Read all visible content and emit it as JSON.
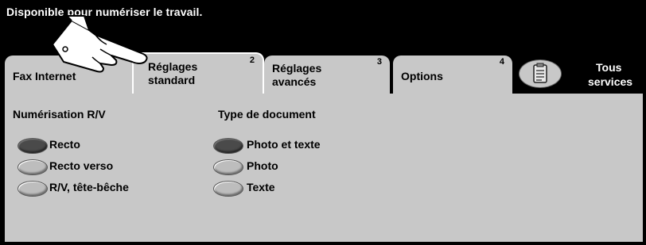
{
  "status": {
    "message": "Disponible pour numériser le travail."
  },
  "tabs": [
    {
      "label": "Fax Internet",
      "number": ""
    },
    {
      "label_line1": "Réglages",
      "label_line2": "standard",
      "number": "2"
    },
    {
      "label_line1": "Réglages",
      "label_line2": "avancés",
      "number": "3"
    },
    {
      "label": "Options",
      "number": "4"
    }
  ],
  "all_services": {
    "line1": "Tous",
    "line2": "services",
    "icon": "clipboard-icon"
  },
  "sections": {
    "duplex": {
      "title": "Numérisation R/V",
      "options": [
        "Recto",
        "Recto verso",
        "R/V, tête-bêche"
      ],
      "selected": "Recto"
    },
    "doc_type": {
      "title": "Type de document",
      "options": [
        "Photo et texte",
        "Photo",
        "Texte"
      ],
      "selected": "Photo et texte"
    }
  },
  "colors": {
    "background": "#000000",
    "panel": "#c8c8c8",
    "selected_radio": "#4a4a4a"
  }
}
